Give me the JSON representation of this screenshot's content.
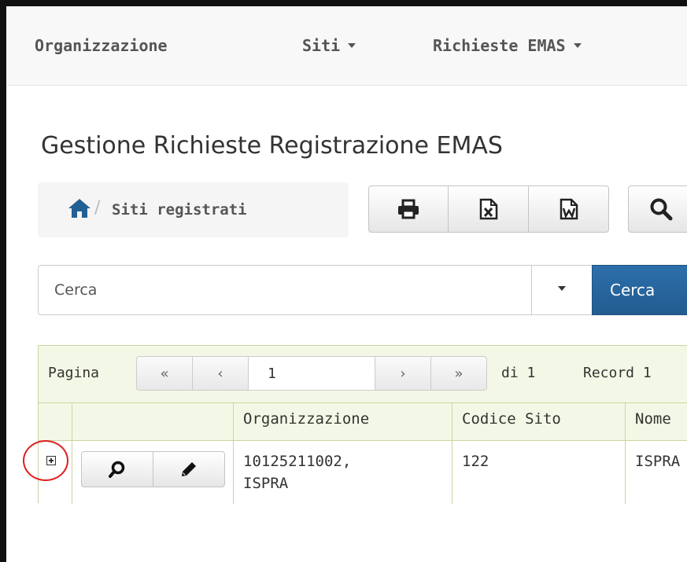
{
  "navbar": {
    "items": [
      {
        "label": "Organizzazione",
        "has_caret": false
      },
      {
        "label": "Siti",
        "has_caret": true
      },
      {
        "label": "Richieste EMAS",
        "has_caret": true
      }
    ]
  },
  "page": {
    "title": "Gestione Richieste Registrazione EMAS"
  },
  "breadcrumb": {
    "home_icon": "home-icon",
    "separator": "/",
    "label": "Siti registrati"
  },
  "toolbar": {
    "buttons": [
      {
        "icon": "print-icon"
      },
      {
        "icon": "excel-file-icon"
      },
      {
        "icon": "word-file-icon"
      },
      {
        "icon": "search-icon"
      }
    ]
  },
  "search": {
    "placeholder": "Cerca",
    "button_label": "Cerca"
  },
  "pager": {
    "label": "Pagina",
    "first": "«",
    "prev": "‹",
    "current": "1",
    "next": "›",
    "last": "»",
    "of_label": "di 1",
    "records_label": "Record 1"
  },
  "table": {
    "columns": [
      "",
      "",
      "Organizzazione",
      "Codice Sito",
      "Nome"
    ],
    "rows": [
      {
        "organizzazione_line1": "10125211002,",
        "organizzazione_line2": "ISPRA",
        "codice_sito": "122",
        "nome": "ISPRA"
      }
    ]
  },
  "colors": {
    "accent": "#245f94",
    "grid_border": "#c8d6a0",
    "grid_header_bg": "#f3f8e6",
    "highlight": "#e02020"
  }
}
